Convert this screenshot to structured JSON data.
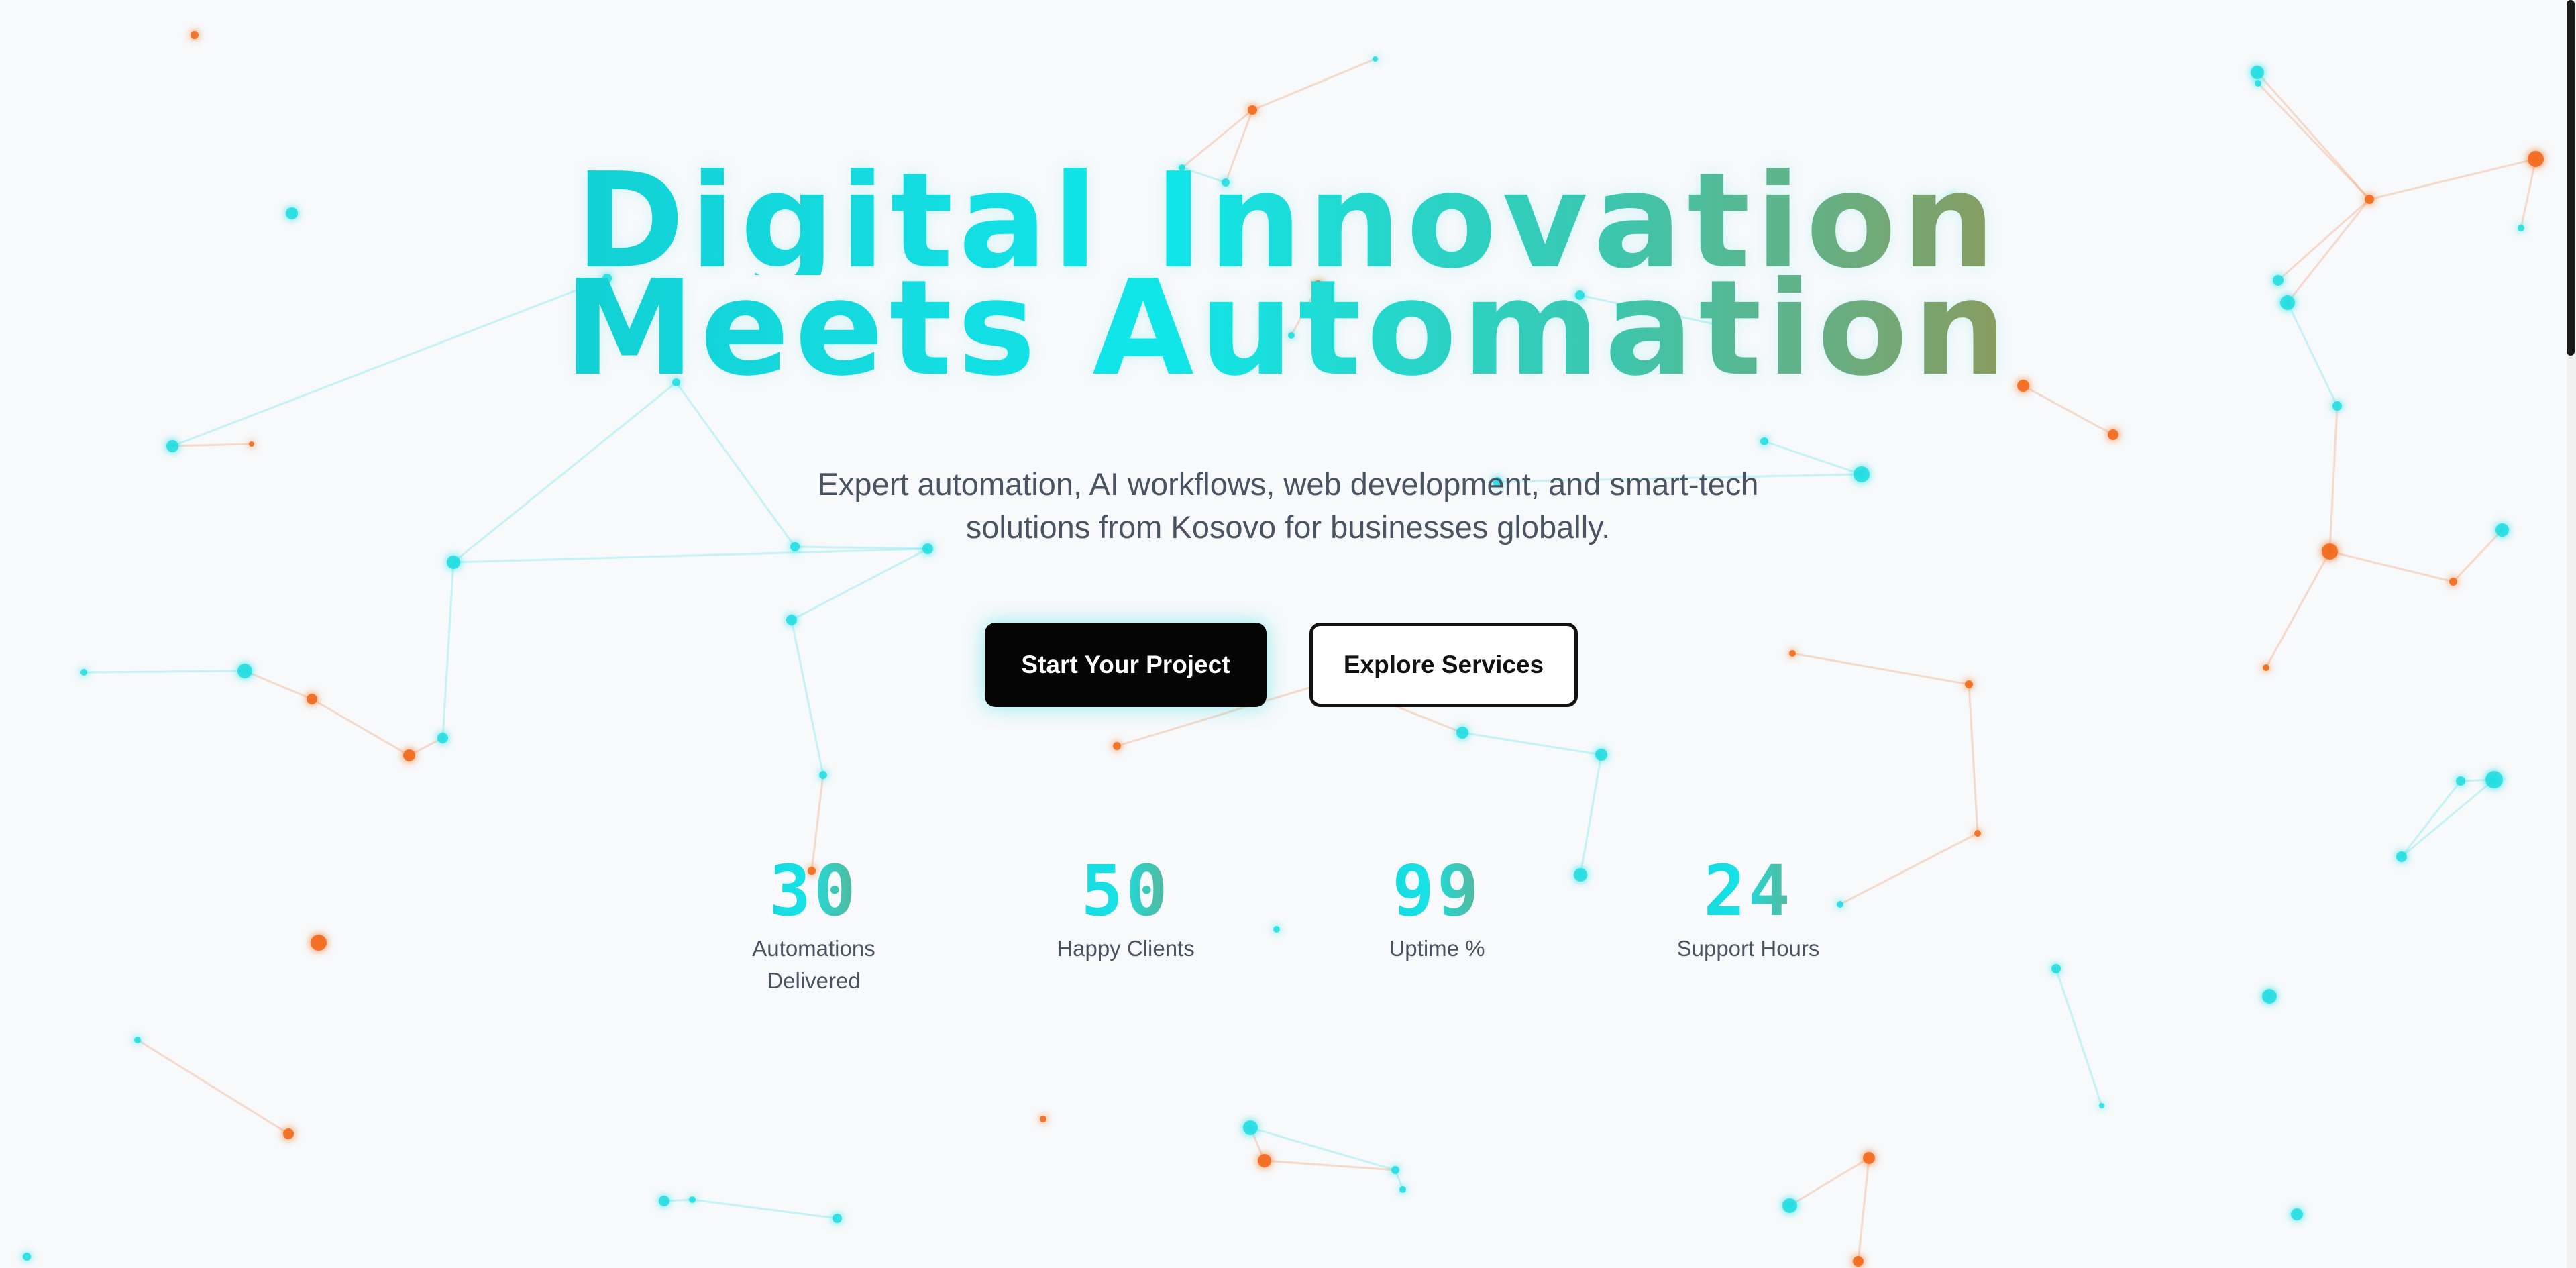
{
  "hero": {
    "title_line1": "Digital Innovation",
    "title_line2": "Meets Automation",
    "subtitle": "Expert automation, AI workflows, web development, and smart-tech solutions from Kosovo for businesses globally."
  },
  "buttons": {
    "primary_label": "Start Your Project",
    "secondary_label": "Explore Services"
  },
  "stats": [
    {
      "value": "30",
      "label": "Automations Delivered"
    },
    {
      "value": "50",
      "label": "Happy Clients"
    },
    {
      "value": "99",
      "label": "Uptime %"
    },
    {
      "value": "24",
      "label": "Support Hours"
    }
  ],
  "colors": {
    "cyan": "#14dce0",
    "orange": "#f26a1b",
    "background": "#f7f9fb",
    "text": "#4a5361"
  }
}
